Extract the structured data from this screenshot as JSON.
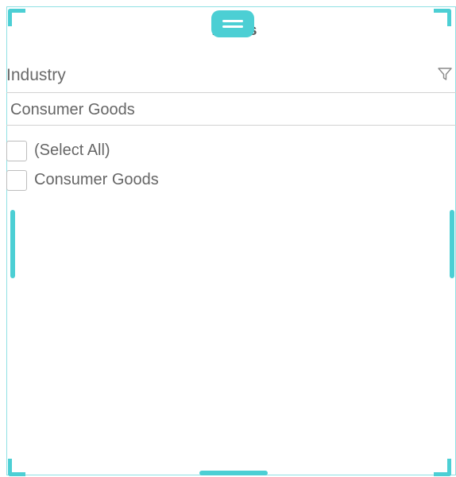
{
  "panel": {
    "title": "Filters",
    "accent_color": "#4ccfd4",
    "border_color": "#8fe0e4"
  },
  "filter": {
    "field_label": "Industry",
    "filter_icon": "funnel-icon",
    "search_value": "Consumer Goods",
    "options": [
      {
        "label": "(Select All)",
        "checked": false
      },
      {
        "label": "Consumer Goods",
        "checked": false
      }
    ]
  }
}
